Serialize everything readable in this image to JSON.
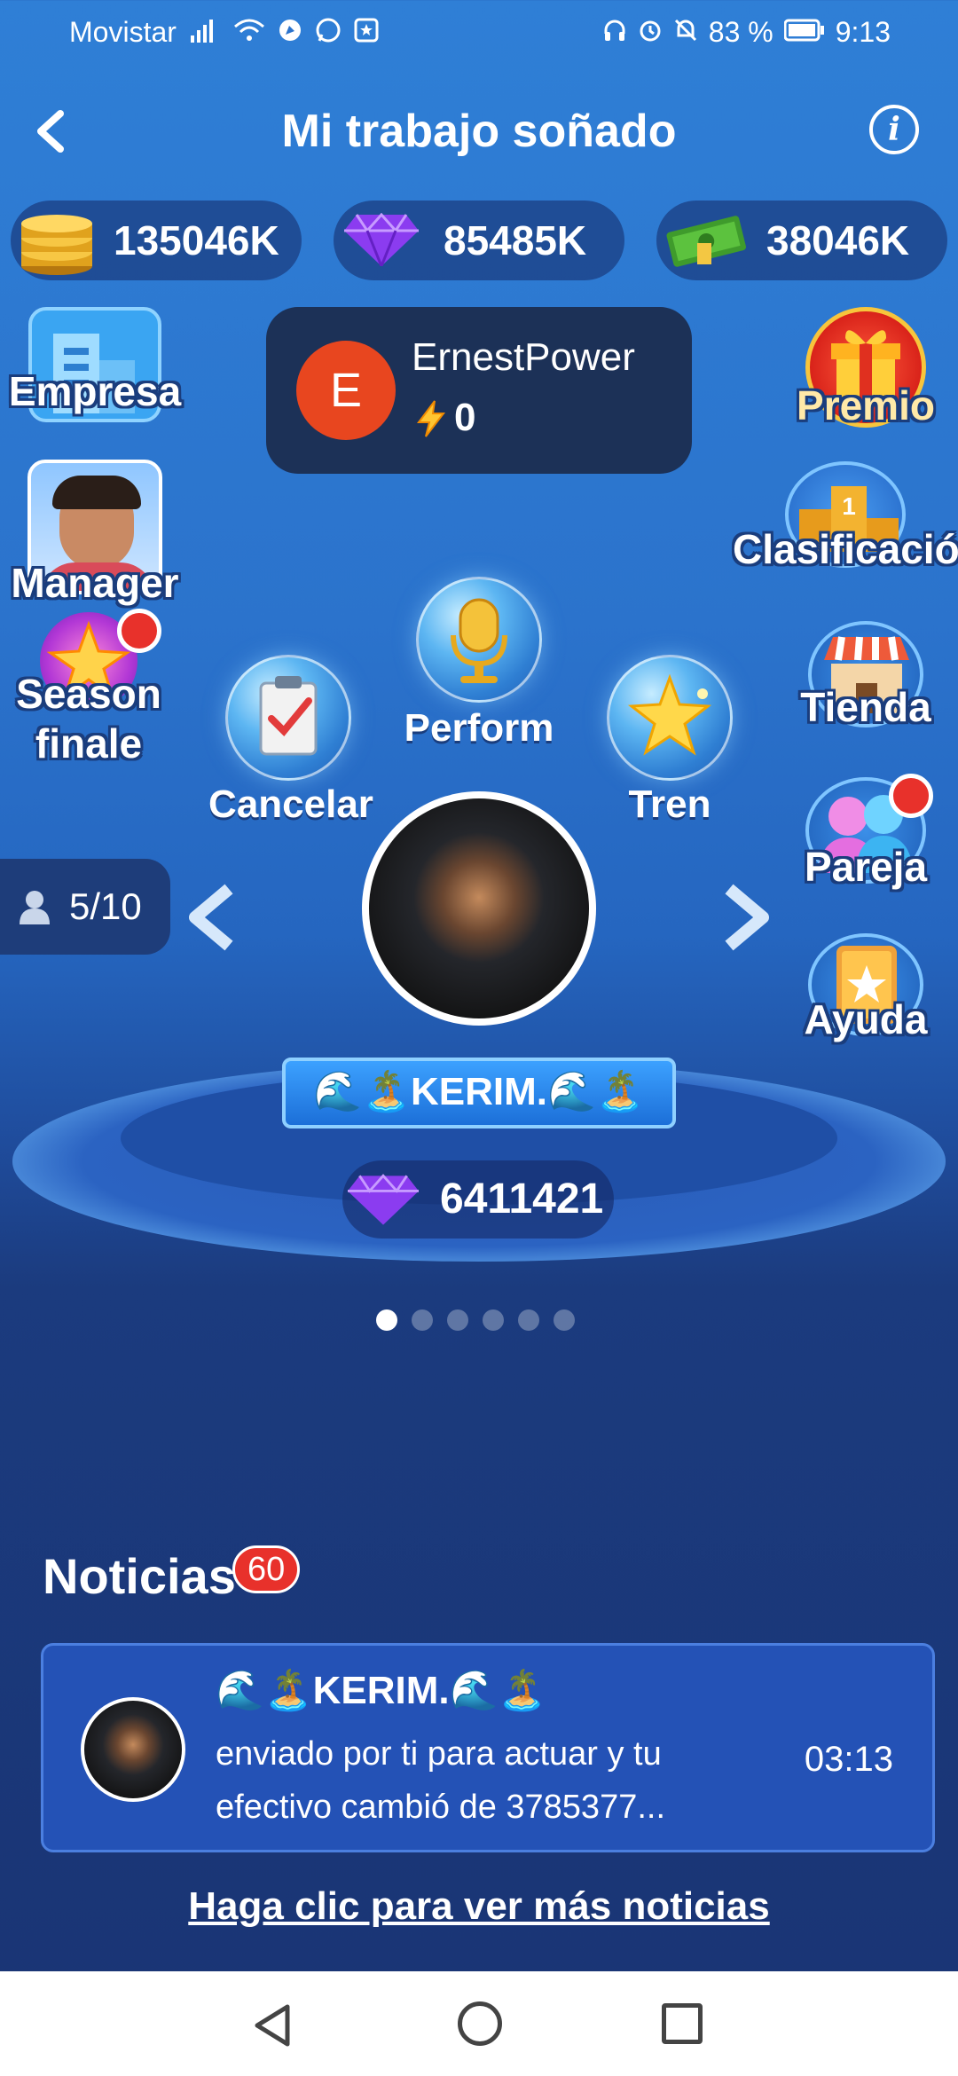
{
  "status_bar": {
    "carrier": "Movistar",
    "battery": "83 %",
    "time": "9:13"
  },
  "header": {
    "title": "Mi trabajo soñado"
  },
  "currencies": {
    "coins": "135046K",
    "gems": "85485K",
    "cash": "38046K"
  },
  "user_card": {
    "initial": "E",
    "name": "ErnestPower",
    "power": "0"
  },
  "left_menu": {
    "empresa": "Empresa",
    "manager": "Manager",
    "season": "Season",
    "finale": "finale"
  },
  "right_menu": {
    "premio": "Premio",
    "clasificacion": "Clasificació",
    "tienda": "Tienda",
    "pareja": "Pareja",
    "ayuda": "Ayuda"
  },
  "actions": {
    "perform": "Perform",
    "cancelar": "Cancelar",
    "tren": "Tren"
  },
  "performer": {
    "count": "5/10",
    "name": "🌊🏝️KERIM.🌊🏝️",
    "gems": "6411421"
  },
  "carousel": {
    "pages": 6,
    "active": 0
  },
  "news": {
    "title": "Noticias",
    "badge": "60",
    "item": {
      "name": "🌊🏝️KERIM.🌊🏝️",
      "text": "enviado por ti para actuar y tu efectivo cambió de 3785377...",
      "time": "03:13"
    },
    "more_link": "Haga clic para ver más noticias"
  },
  "colors": {
    "accent_red": "#e8312b",
    "avatar_orange": "#e8461f",
    "card_dark": "#1c3157",
    "news_card": "#2452b6"
  }
}
